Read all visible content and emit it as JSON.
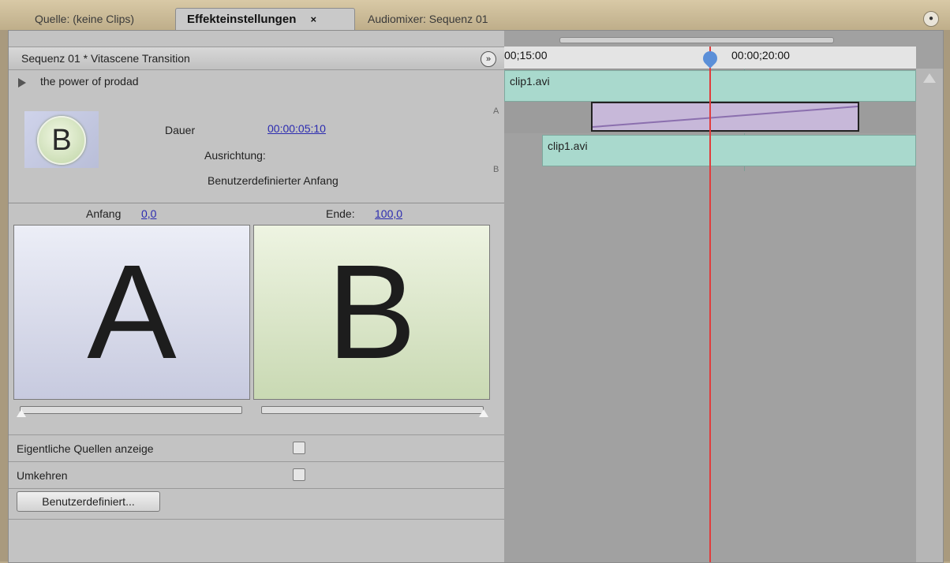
{
  "tabs": [
    {
      "label": "Quelle: (keine Clips)",
      "active": false
    },
    {
      "label": "Effekteinstellungen",
      "active": true,
      "close": "×"
    },
    {
      "label": "Audiomixer: Sequenz 01",
      "active": false
    }
  ],
  "panel_menu_icon": "panel-menu-icon",
  "header": {
    "title": "Sequenz 01 * Vitascene Transition",
    "expand_icon": "double-chevron-right-icon",
    "expand_glyph": "»"
  },
  "effect": {
    "name": "the power of prodad",
    "thumb_letter": "B"
  },
  "params": {
    "dauer_label": "Dauer",
    "dauer_value": "00:00:05:10",
    "ausrichtung_label": "Ausrichtung:",
    "ausrichtung_value": "Benutzerdefinierter Anfang"
  },
  "range": {
    "start_label": "Anfang",
    "start_value": "0,0",
    "end_label": "Ende:",
    "end_value": "100,0"
  },
  "preview": {
    "a_letter": "A",
    "b_letter": "B",
    "start_pct": 0,
    "end_pct": 100
  },
  "options": [
    {
      "label": "Eigentliche Quellen anzeige",
      "checked": false
    },
    {
      "label": "Umkehren",
      "checked": false
    }
  ],
  "custom_button": "Benutzerdefiniert...",
  "timeline": {
    "time_start": "00;15:00",
    "time_mid": "00:00;20:00",
    "clip_a": "clip1.avi",
    "clip_b": "clip1.avi",
    "track_labels": {
      "a": "A",
      "b": "B"
    }
  },
  "colors": {
    "playhead": "#e03c3c",
    "clip": "#a9d9cd",
    "transition": "#c7b8d9"
  }
}
